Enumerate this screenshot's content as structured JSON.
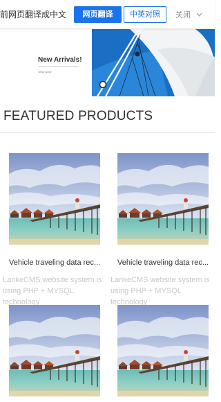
{
  "translate_bar": {
    "prompt": "前网页翻译成中文",
    "translate_button": "网页翻译",
    "bilingual_button": "中英对照",
    "close_label": "关闭"
  },
  "hero": {
    "title": "New Arrivals!",
    "subtitle": "Shop Now!",
    "accent_color": "#1a6fc4"
  },
  "section": {
    "title": "FEATURED PRODUCTS"
  },
  "products": [
    {
      "title": "Vehicle traveling data rec...",
      "desc_line1": "LankeCMS website system is",
      "desc_line2": "using PHP + MYSQL technology"
    },
    {
      "title": "Vehicle traveling data rec...",
      "desc_line1": "LankeCMS website system is",
      "desc_line2": "using PHP + MYSQL technology"
    },
    {
      "title": "",
      "desc_line1": "",
      "desc_line2": ""
    },
    {
      "title": "",
      "desc_line1": "",
      "desc_line2": ""
    }
  ],
  "colors": {
    "primary_blue": "#1a73e8",
    "muted_text": "#c9c9c9"
  }
}
